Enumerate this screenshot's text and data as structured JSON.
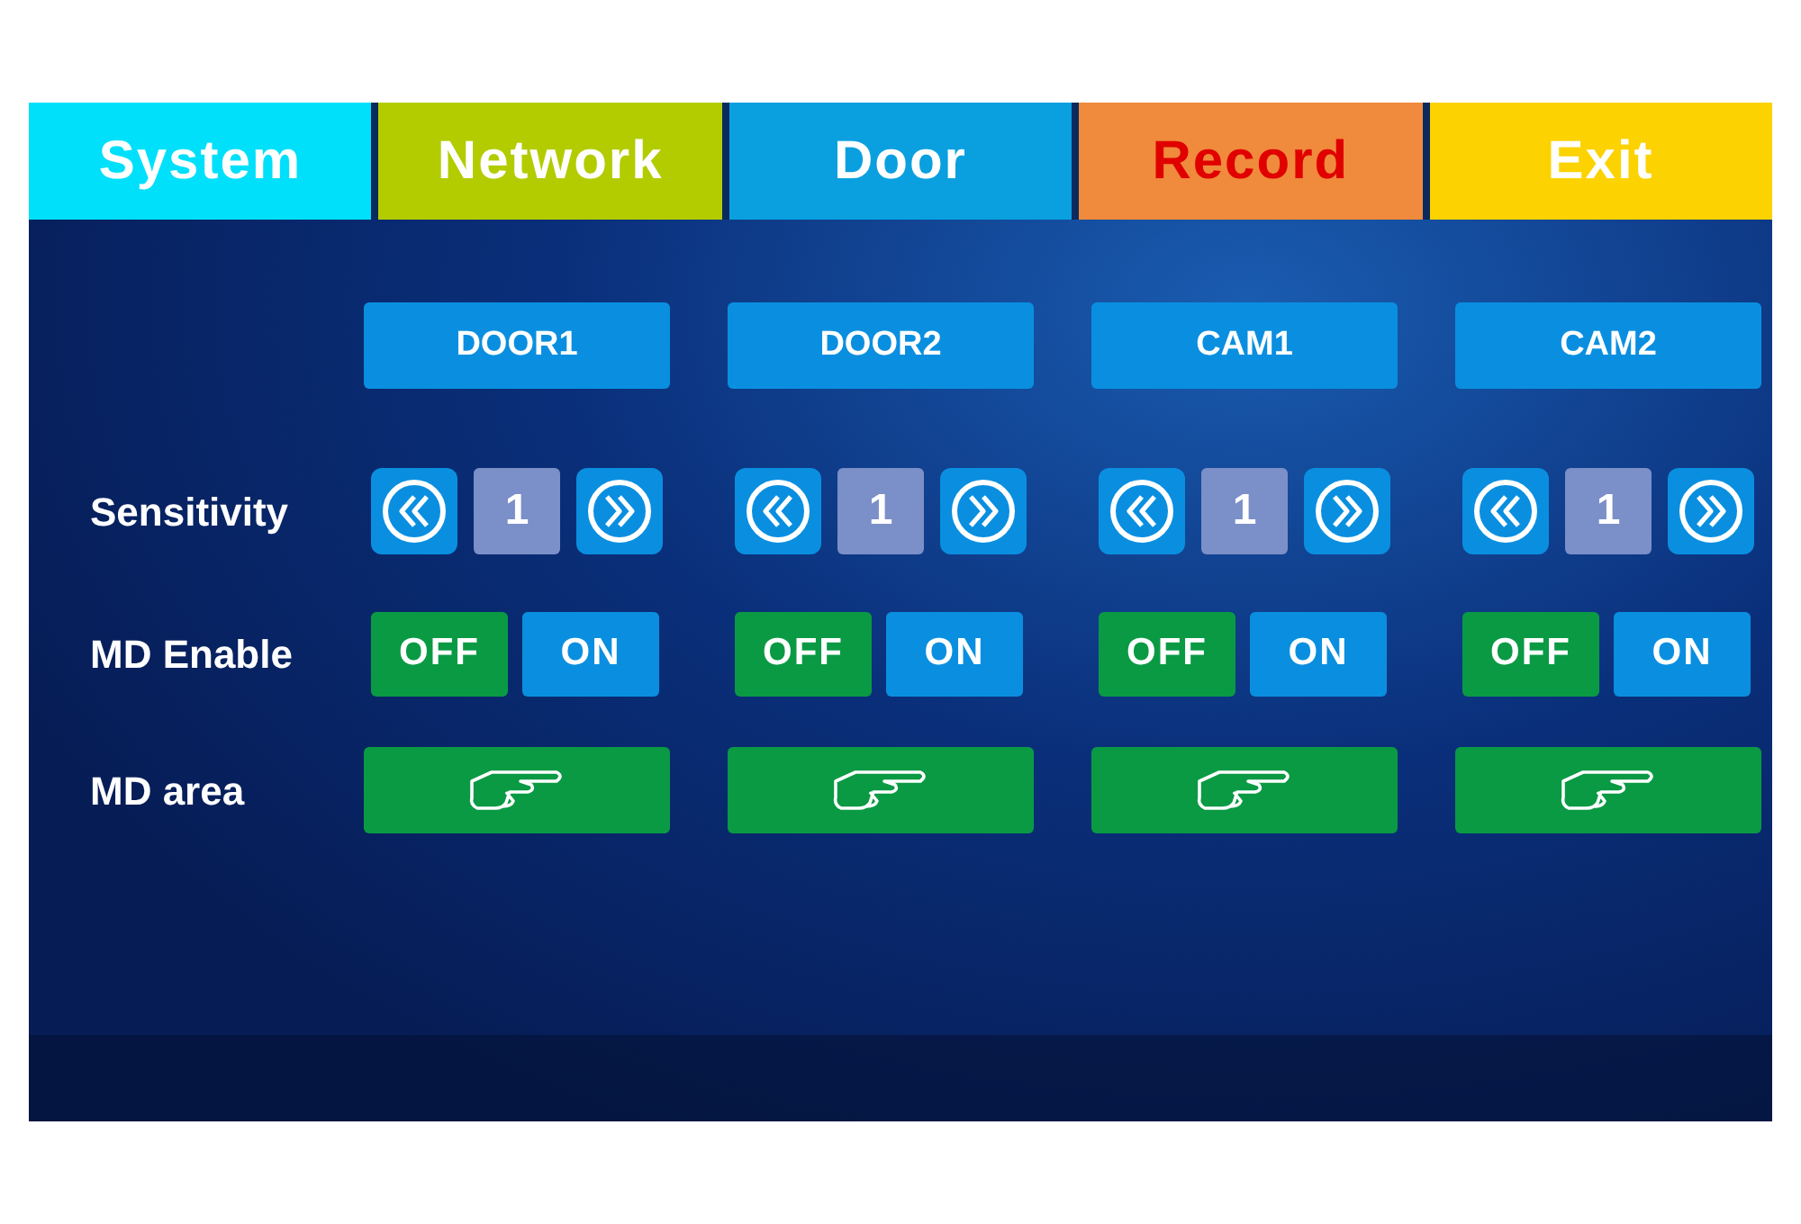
{
  "tabs": [
    {
      "label": "System",
      "color": "#00e0fa",
      "selected": false
    },
    {
      "label": "Network",
      "color": "#b3cc00",
      "selected": false
    },
    {
      "label": "Door",
      "color": "#0aa0e0",
      "selected": false
    },
    {
      "label": "Record",
      "color": "#f08a3c",
      "selected": true
    },
    {
      "label": "Exit",
      "color": "#fcd200",
      "selected": false
    }
  ],
  "row_labels": {
    "sensitivity": "Sensitivity",
    "md_enable": "MD Enable",
    "md_area": "MD area"
  },
  "cameras": [
    {
      "name": "DOOR1",
      "sensitivity": "1",
      "md_enable": false,
      "off_label": "OFF",
      "on_label": "ON"
    },
    {
      "name": "DOOR2",
      "sensitivity": "1",
      "md_enable": false,
      "off_label": "OFF",
      "on_label": "ON"
    },
    {
      "name": "CAM1",
      "sensitivity": "1",
      "md_enable": false,
      "off_label": "OFF",
      "on_label": "ON"
    },
    {
      "name": "CAM2",
      "sensitivity": "1",
      "md_enable": false,
      "off_label": "OFF",
      "on_label": "ON"
    }
  ]
}
